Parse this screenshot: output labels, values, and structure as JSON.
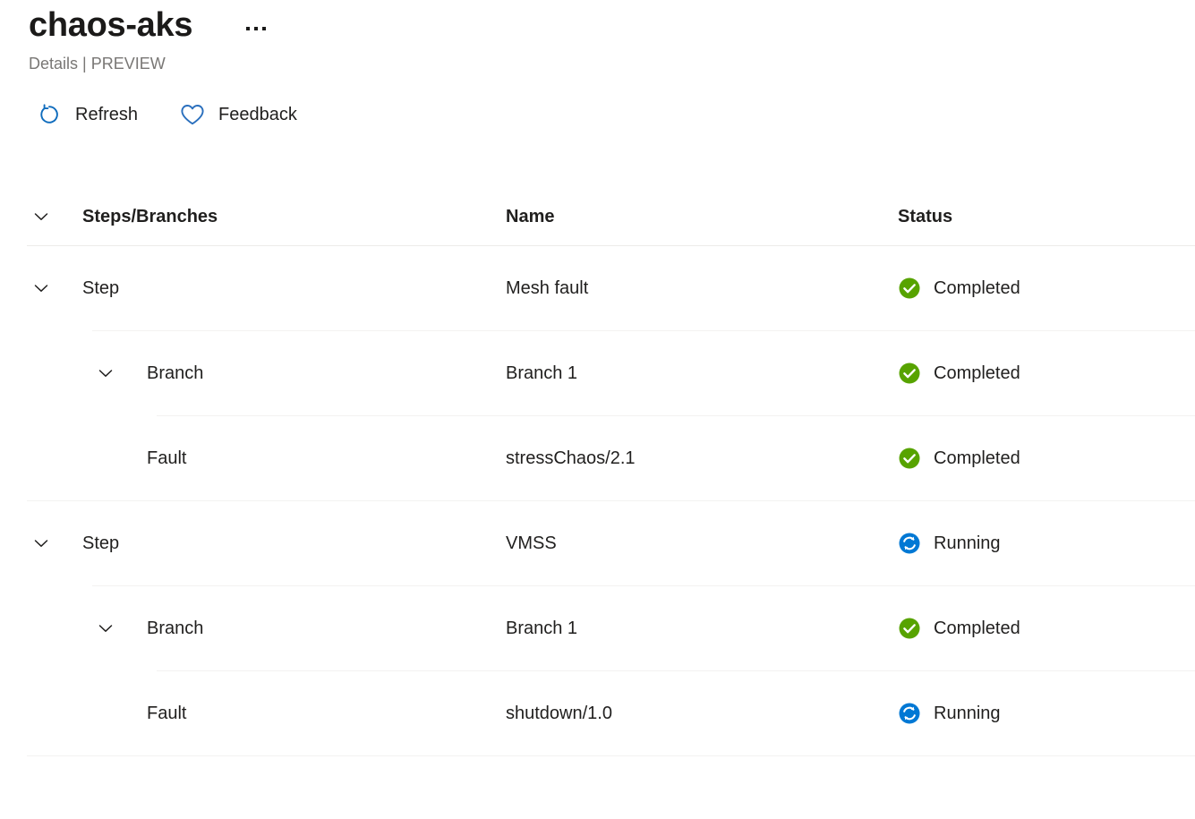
{
  "header": {
    "title": "chaos-aks",
    "subtitle": "Details | PREVIEW",
    "more_options_label": "More options"
  },
  "command_bar": {
    "commands": [
      {
        "label": "Refresh",
        "icon": "refresh-icon"
      },
      {
        "label": "Feedback",
        "icon": "heart-icon"
      }
    ]
  },
  "table": {
    "columns": {
      "tree": "Steps/Branches",
      "name": "Name",
      "status": "Status"
    },
    "rows": [
      {
        "type": "Step",
        "name": "Mesh fault",
        "status": "Completed",
        "status_kind": "completed",
        "level": 0,
        "expandable": true,
        "expanded": true
      },
      {
        "type": "Branch",
        "name": "Branch 1",
        "status": "Completed",
        "status_kind": "completed",
        "level": 1,
        "expandable": true,
        "expanded": true
      },
      {
        "type": "Fault",
        "name": "stressChaos/2.1",
        "status": "Completed",
        "status_kind": "completed",
        "level": 2,
        "expandable": false,
        "expanded": false
      },
      {
        "type": "Step",
        "name": "VMSS",
        "status": "Running",
        "status_kind": "running",
        "level": 0,
        "expandable": true,
        "expanded": true
      },
      {
        "type": "Branch",
        "name": "Branch 1",
        "status": "Completed",
        "status_kind": "completed",
        "level": 1,
        "expandable": true,
        "expanded": true
      },
      {
        "type": "Fault",
        "name": "shutdown/1.0",
        "status": "Running",
        "status_kind": "running",
        "level": 2,
        "expandable": false,
        "expanded": false
      }
    ]
  },
  "colors": {
    "accent_blue": "#0f6cbd",
    "status_completed_green": "#57a300",
    "status_running_blue": "#0078d4",
    "title_text": "#1b1a19",
    "subtitle_text": "#797775",
    "separator": "#f3f2f1"
  }
}
